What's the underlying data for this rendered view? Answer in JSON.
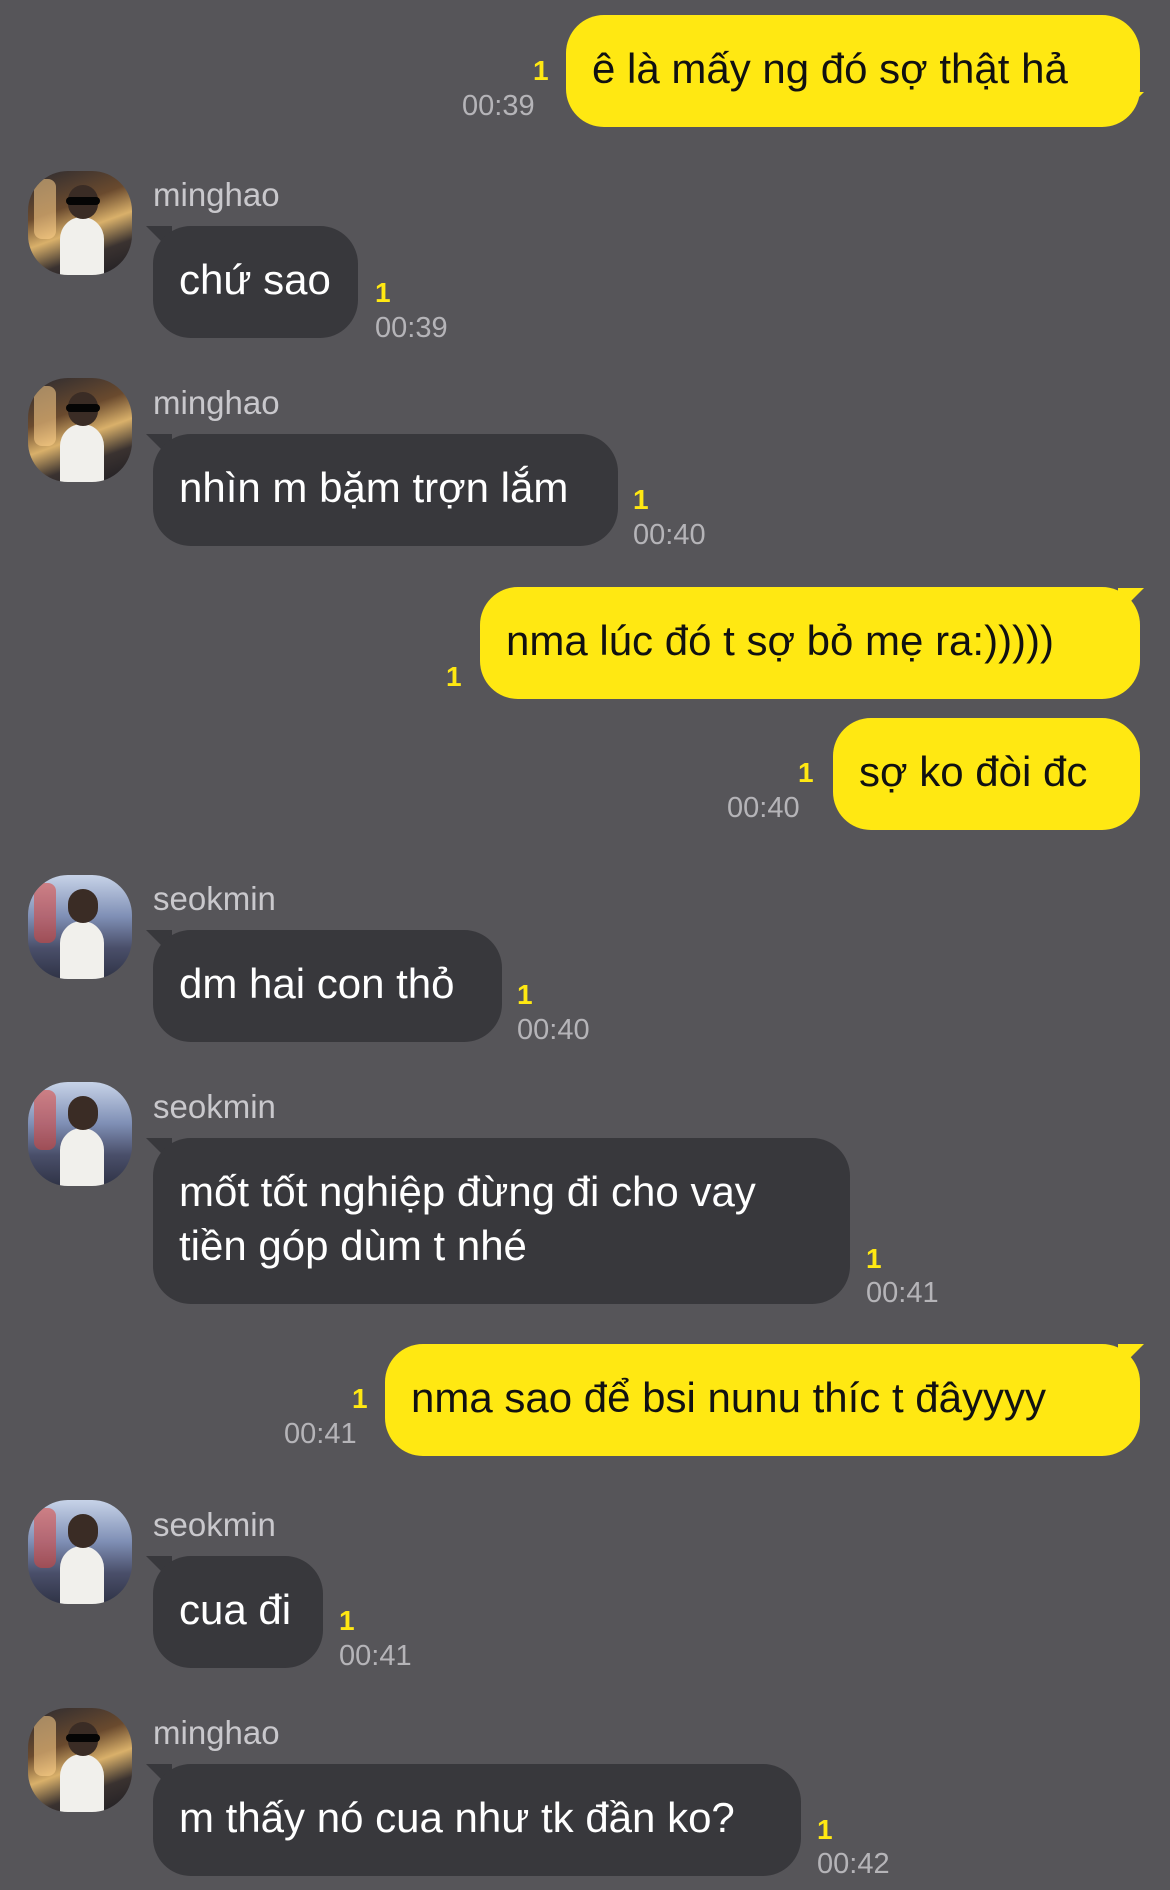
{
  "colors": {
    "background": "#565559",
    "outgoing_bubble": "#FFE812",
    "incoming_bubble": "#38383C",
    "unread_count": "#FFE812",
    "timestamp": "#B5B4B8"
  },
  "messages": [
    {
      "direction": "out",
      "text": "ê là mấy ng đó sợ thật hả",
      "unread": "1",
      "time": "00:39"
    },
    {
      "direction": "in",
      "sender": "minghao",
      "avatar": "minghao-avatar",
      "text": "chứ sao",
      "unread": "1",
      "time": "00:39"
    },
    {
      "direction": "in",
      "sender": "minghao",
      "avatar": "minghao-avatar",
      "text": "nhìn m bặm trợn lắm",
      "unread": "1",
      "time": "00:40"
    },
    {
      "direction": "out",
      "text": "nma lúc đó t sợ bỏ mẹ ra:)))))",
      "unread": "1",
      "time": ""
    },
    {
      "direction": "out",
      "text": "sợ ko đòi đc",
      "unread": "1",
      "time": "00:40"
    },
    {
      "direction": "in",
      "sender": "seokmin",
      "avatar": "seokmin-avatar",
      "text": "dm hai con thỏ",
      "unread": "1",
      "time": "00:40"
    },
    {
      "direction": "in",
      "sender": "seokmin",
      "avatar": "seokmin-avatar",
      "text": "mốt tốt nghiệp đừng đi cho vay tiền góp dùm t nhé",
      "unread": "1",
      "time": "00:41"
    },
    {
      "direction": "out",
      "text": "nma sao để bsi nunu thíc t đâyyyy",
      "unread": "1",
      "time": "00:41"
    },
    {
      "direction": "in",
      "sender": "seokmin",
      "avatar": "seokmin-avatar",
      "text": "cua đi",
      "unread": "1",
      "time": "00:41"
    },
    {
      "direction": "in",
      "sender": "minghao",
      "avatar": "minghao-avatar",
      "text": "m thấy nó cua như tk đần ko?",
      "unread": "1",
      "time": "00:42"
    }
  ]
}
